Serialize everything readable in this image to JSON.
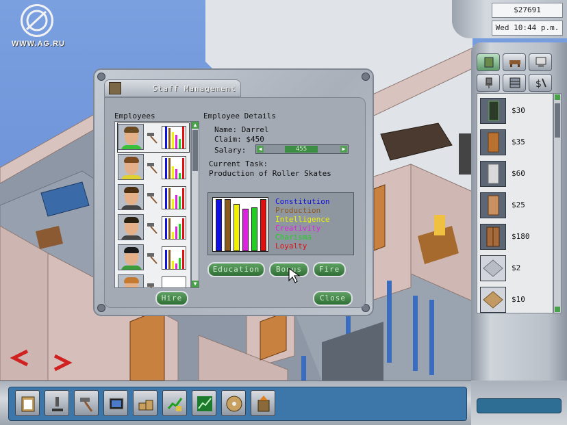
{
  "watermark": {
    "logo_text": "WWW.AG.RU"
  },
  "status": {
    "money": "$27691",
    "time": "Wed 10:44 p.m."
  },
  "build_panel": {
    "category_icons": [
      "door-window-icon",
      "desk-icon",
      "computer-icon",
      "chair-icon",
      "shelf-icon",
      "money-tools-icon"
    ],
    "items": [
      {
        "price": "$30",
        "icon": "door-glass-icon"
      },
      {
        "price": "$35",
        "icon": "door-wood-icon"
      },
      {
        "price": "$60",
        "icon": "door-metal-icon"
      },
      {
        "price": "$25",
        "icon": "door-panel-icon"
      },
      {
        "price": "$180",
        "icon": "door-double-icon"
      },
      {
        "price": "$2",
        "icon": "floor-tile-icon"
      },
      {
        "price": "$10",
        "icon": "floor-carpet-icon"
      }
    ]
  },
  "toolbar": {
    "buttons": [
      "staff-clipboard-icon",
      "research-microscope-icon",
      "production-hammer-icon",
      "marketing-tv-icon",
      "warehouse-boxes-icon",
      "finance-chart-icon",
      "stock-chart-icon",
      "disc-icon",
      "building-icon"
    ]
  },
  "dialog": {
    "title": "Staff Management",
    "employees_label": "Employees",
    "details_label": "Employee Details",
    "name_line": "Name: Darrel",
    "claim_line": "Claim: $450",
    "salary_label": "Salary:",
    "salary_value": "455",
    "task_label": "Current Task:",
    "task_value": "Production of Roller Skates",
    "stats": [
      {
        "label": "Constitution",
        "color": "#1010e0"
      },
      {
        "label": "Production",
        "color": "#8a5a1c"
      },
      {
        "label": "Intelligence",
        "color": "#f0f000"
      },
      {
        "label": "Creativity",
        "color": "#e020e0"
      },
      {
        "label": "Charisma",
        "color": "#20d020"
      },
      {
        "label": "Loyalty",
        "color": "#e01010"
      }
    ],
    "stat_values": [
      0.97,
      0.97,
      0.88,
      0.8,
      0.82,
      0.98
    ],
    "buttons": {
      "education": "Education",
      "bonus": "Bonus",
      "fire": "Fire",
      "hire": "Hire",
      "close": "Close"
    },
    "employee_roles": [
      "hammer-icon",
      "hammer-icon",
      "hammer-icon",
      "hammer-icon",
      "hammer-icon",
      "hammer-icon"
    ]
  }
}
